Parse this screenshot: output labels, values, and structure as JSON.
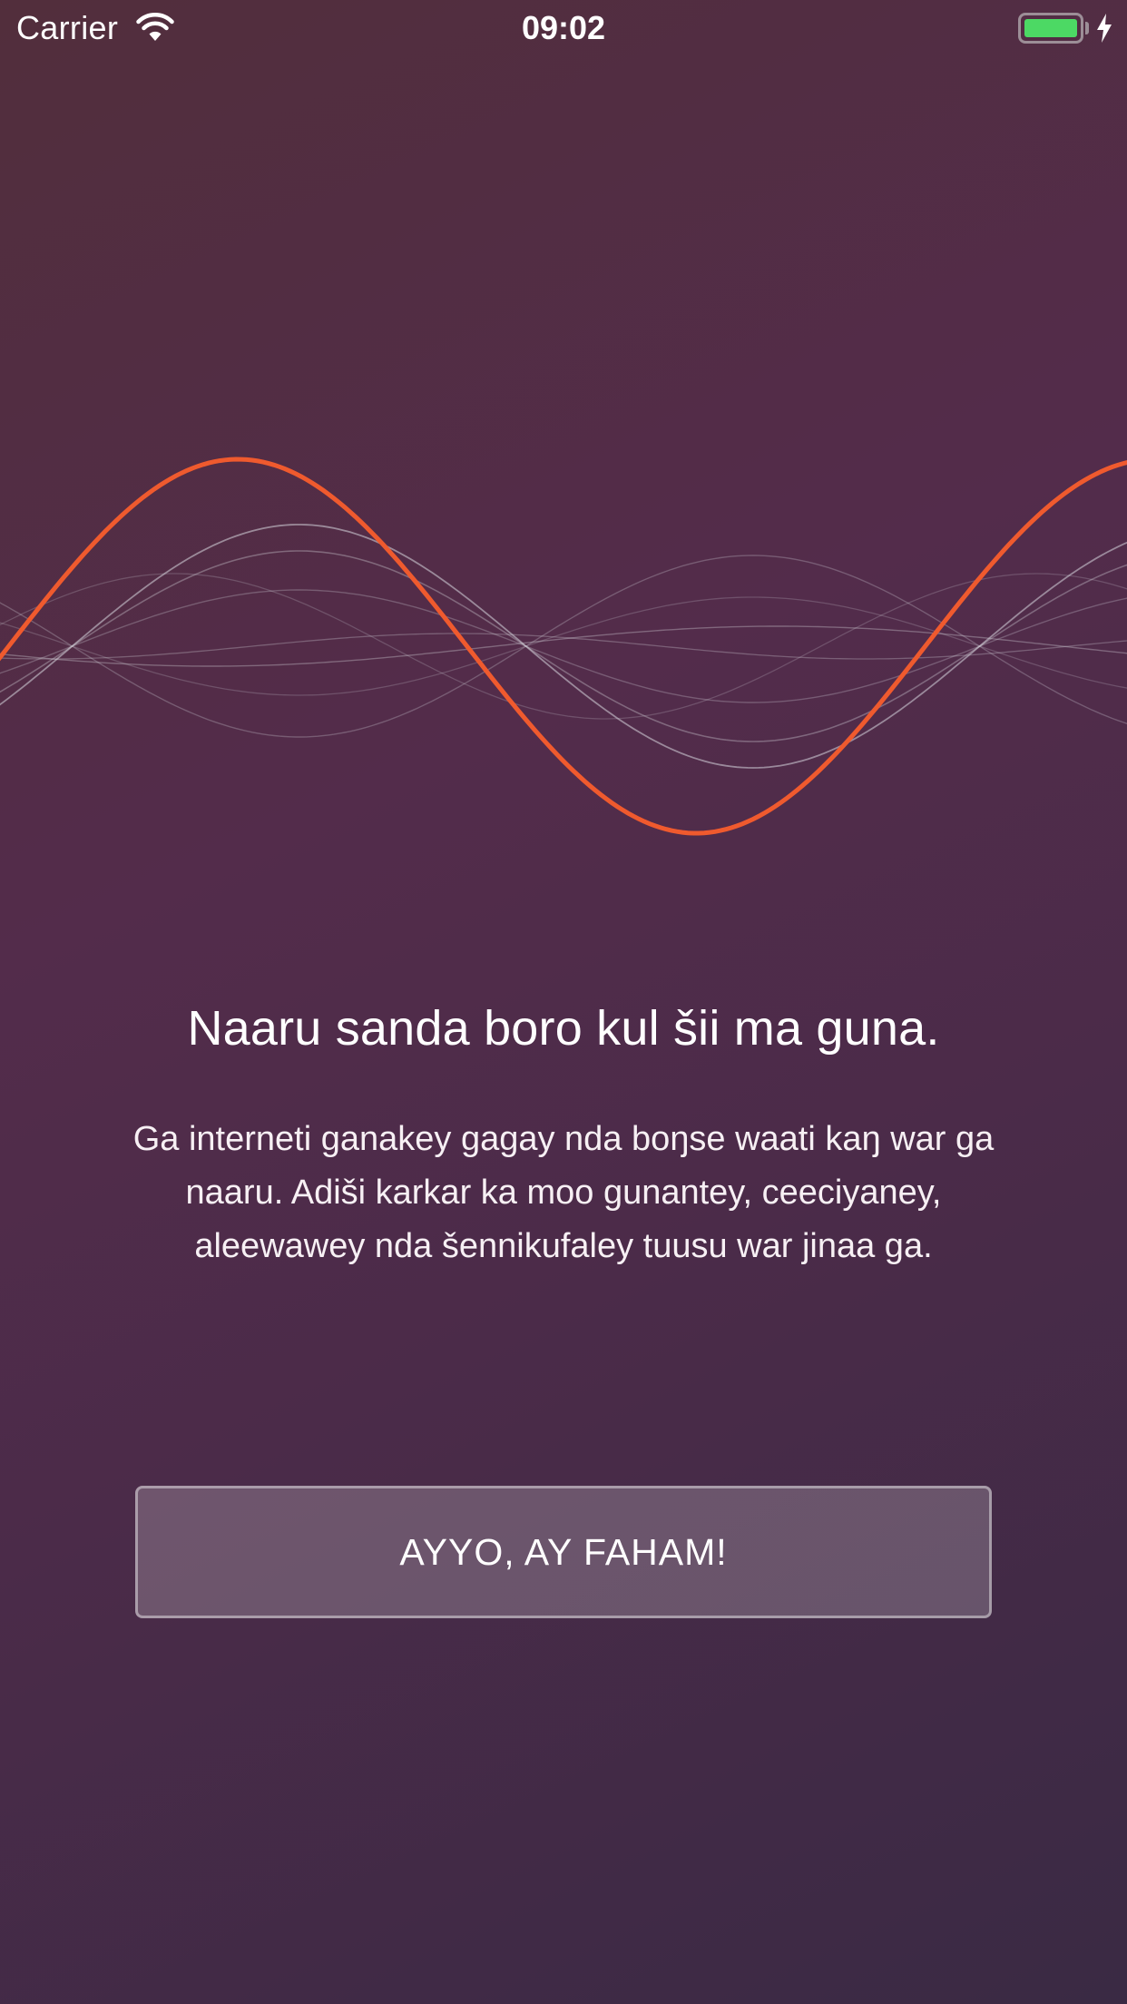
{
  "status_bar": {
    "carrier": "Carrier",
    "time": "09:02",
    "icons": [
      "wifi-icon",
      "battery-icon",
      "charging-bolt-icon"
    ],
    "battery_level": 1.0,
    "battery_color": "#4cd964"
  },
  "illustration": {
    "name": "sound-wave",
    "accent_color": "#ef5a2e"
  },
  "content": {
    "title": "Naaru sanda boro kul šii ma guna.",
    "body": "Ga interneti ganakey gagay nda boŋse waati kaŋ war ga naaru. Adiši karkar ka moo gunantey, ceeciyaney, aleewawey nda šennikufaley tuusu war jinaa ga."
  },
  "actions": {
    "confirm_label": "AYYO, AY FAHAM!"
  }
}
